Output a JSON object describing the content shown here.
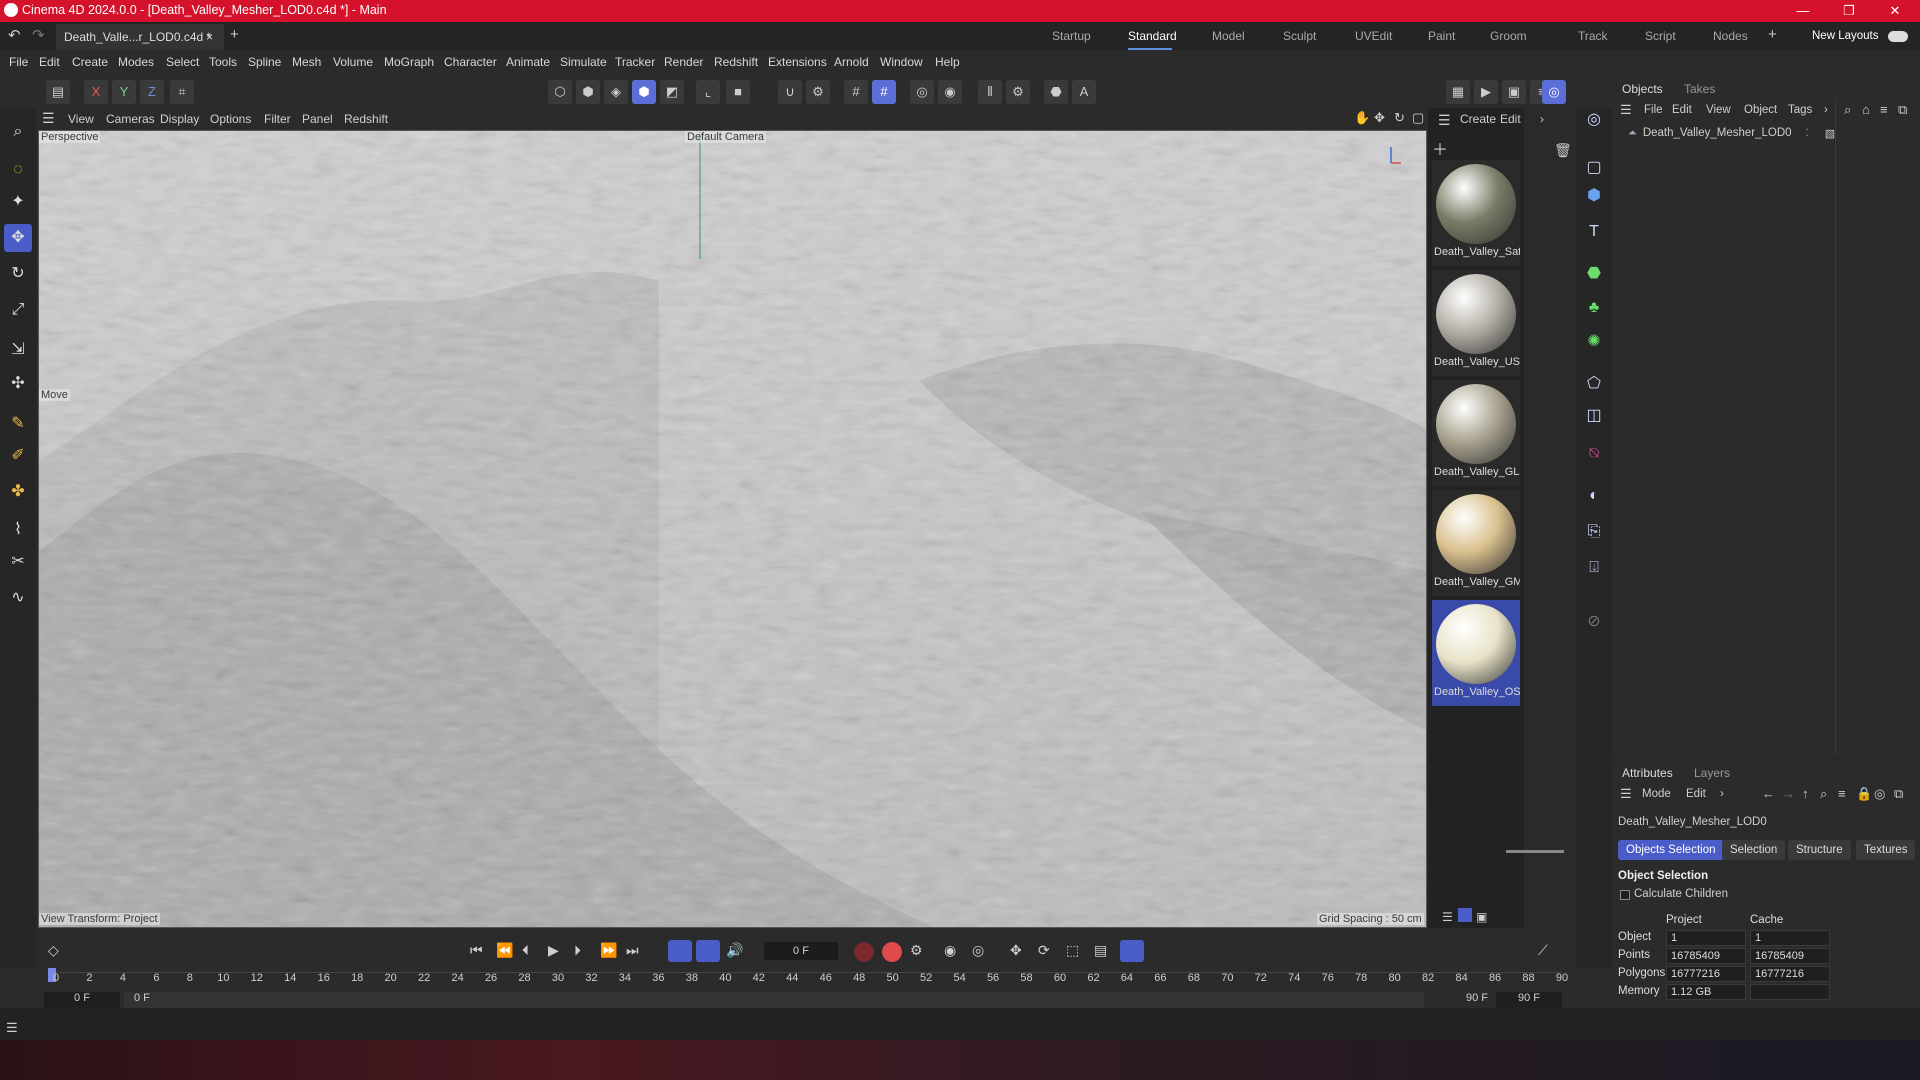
{
  "window": {
    "title": "Cinema 4D 2024.0.0 - [Death_Valley_Mesher_LOD0.c4d *] - Main",
    "minimize": "—",
    "restore": "❐",
    "close": "✕"
  },
  "doc_tab": {
    "label": "Death_Valle...r_LOD0.c4d *",
    "close": "×",
    "add": "+"
  },
  "layouts": {
    "items": [
      "Startup",
      "Standard",
      "Model",
      "Sculpt",
      "UVEdit",
      "Paint",
      "Groom",
      "Track",
      "Script",
      "Nodes"
    ],
    "active": "Standard",
    "add": "+",
    "new_layouts": "New Layouts"
  },
  "menu": [
    "File",
    "Edit",
    "Create",
    "Modes",
    "Select",
    "Tools",
    "Spline",
    "Mesh",
    "Volume",
    "MoGraph",
    "Character",
    "Animate",
    "Simulate",
    "Tracker",
    "Render",
    "Redshift",
    "Extensions",
    "Arnold",
    "Window",
    "Help"
  ],
  "axes": {
    "x": "X",
    "y": "Y",
    "z": "Z"
  },
  "viewport_menu": [
    "View",
    "Cameras",
    "Display",
    "Options",
    "Filter",
    "Panel",
    "Redshift"
  ],
  "viewport": {
    "mode": "Perspective",
    "camera": "Default Camera",
    "tool_hint": "Move",
    "view_transform": "View Transform: Project",
    "grid_spacing": "Grid Spacing : 50 cm"
  },
  "material_manager": {
    "menu": [
      "Create",
      "Edit"
    ],
    "more": "›",
    "materials": [
      {
        "name": "Death_Valley_Sate",
        "color": "#7a7d66"
      },
      {
        "name": "Death_Valley_USA",
        "color": "#b4b0a6"
      },
      {
        "name": "Death_Valley_GLai",
        "color": "#a8a28e"
      },
      {
        "name": "Death_Valley_GMa",
        "color": "#d9c08d"
      },
      {
        "name": "Death_Valley_OSM",
        "color": "#e8e3c8"
      }
    ]
  },
  "objects_panel": {
    "tabs": [
      "Objects",
      "Takes"
    ],
    "menu": [
      "File",
      "Edit",
      "View",
      "Object",
      "Tags"
    ],
    "more": "›",
    "items": [
      {
        "name": "Death_Valley_Mesher_LOD0"
      }
    ]
  },
  "attributes": {
    "tabs": [
      "Attributes",
      "Layers"
    ],
    "menu": [
      "Mode",
      "Edit"
    ],
    "more": "›",
    "object_name": "Death_Valley_Mesher_LOD0",
    "subtabs": [
      "Objects Selection",
      "Selection",
      "Structure",
      "Textures"
    ],
    "section": "Object Selection",
    "calc_children": "Calculate Children",
    "headers": [
      "Project",
      "Cache"
    ],
    "rows": [
      {
        "label": "Object",
        "project": "1",
        "cache": "1"
      },
      {
        "label": "Points",
        "project": "16785409",
        "cache": "16785409"
      },
      {
        "label": "Polygons",
        "project": "16777216",
        "cache": "16777216"
      },
      {
        "label": "Memory",
        "project": "1.12 GB",
        "cache": ""
      }
    ]
  },
  "timeline": {
    "current_frame": "0 F",
    "ticks": [
      "0",
      "2",
      "4",
      "6",
      "8",
      "10",
      "12",
      "14",
      "16",
      "18",
      "20",
      "22",
      "24",
      "26",
      "28",
      "30",
      "32",
      "34",
      "36",
      "38",
      "40",
      "42",
      "44",
      "46",
      "48",
      "50",
      "52",
      "54",
      "56",
      "58",
      "60",
      "62",
      "64",
      "66",
      "68",
      "70",
      "72",
      "74",
      "76",
      "78",
      "80",
      "82",
      "84",
      "86",
      "88",
      "90"
    ],
    "start_a": "0 F",
    "start_b": "0 F",
    "end_a": "90 F",
    "end_b": "90 F"
  },
  "colors": {
    "titlebar": "#d4122b",
    "accent": "#5b6ed8"
  }
}
